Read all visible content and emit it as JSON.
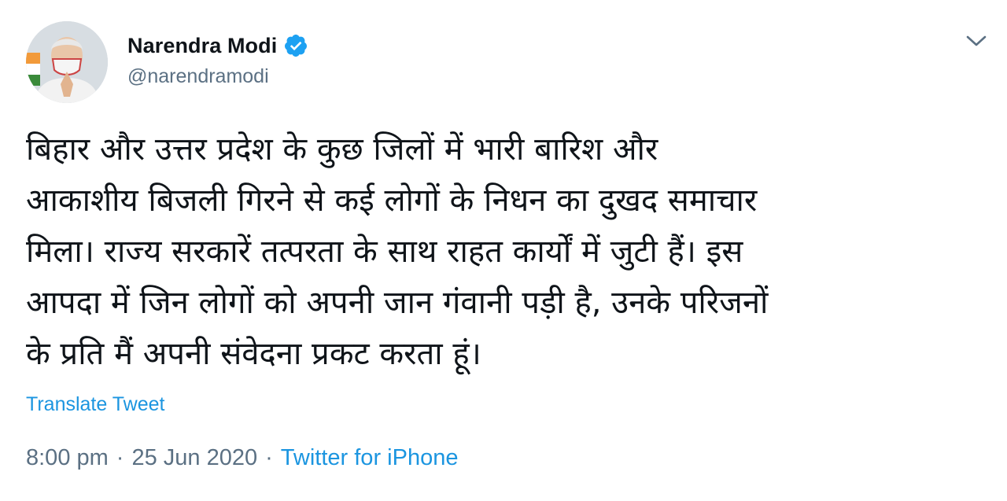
{
  "author": {
    "display_name": "Narendra Modi",
    "handle": "@narendramodi",
    "verified": true,
    "avatar_icon": "profile-photo"
  },
  "tweet": {
    "text_lines": [
      "बिहार और उत्तर प्रदेश के कुछ जिलों में भारी बारिश और",
      "आकाशीय बिजली गिरने से कई लोगों के निधन का दुखद समाचार",
      "मिला। राज्य सरकारें तत्परता के साथ राहत कार्यों में जुटी हैं। इस",
      "आपदा में जिन लोगों को अपनी जान गंवानी पड़ी है, उनके परिजनों",
      "के प्रति मैं अपनी संवेदना प्रकट करता हूं।"
    ],
    "translate_label": "Translate Tweet",
    "time": "8:00 pm",
    "date": "25 Jun 2020",
    "separator": "·",
    "source": "Twitter for iPhone"
  },
  "icons": {
    "verified": "verified-badge-icon",
    "caret": "chevron-down-icon"
  },
  "colors": {
    "link": "#1b95e0",
    "secondary_text": "#5b7083",
    "primary_text": "#0f1419",
    "verified": "#1da1f2"
  }
}
